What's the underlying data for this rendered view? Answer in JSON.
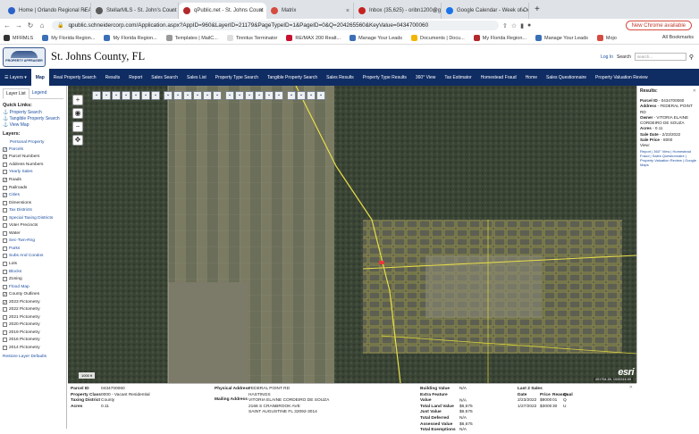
{
  "browser": {
    "tabs": [
      {
        "title": "Home | Orlando Regional REA",
        "color": "#2a62c9",
        "active": false
      },
      {
        "title": "StellarMLS - St. John's Count",
        "color": "#5b5b5b",
        "active": false
      },
      {
        "title": "qPublic.net - St. Johns Count",
        "color": "#b0292b",
        "active": true
      },
      {
        "title": "Matrix",
        "color": "#d64b3f",
        "active": false
      },
      {
        "title": "Inbox (35,625) - oribn1200@g",
        "color": "#c5221f",
        "active": false
      },
      {
        "title": "Google Calendar - Week of Oc",
        "color": "#1a73e8",
        "active": false
      }
    ],
    "url": "qpublic.schneidercorp.com/Application.aspx?AppID=960&LayerID=21179&PageTypeID=1&PageID=0&Q=204265560&KeyValue=0434700060",
    "update_label": "New Chrome available",
    "bookmarks": [
      {
        "label": "MFRMLS",
        "color": "#333"
      },
      {
        "label": "My Florida Region...",
        "color": "#3b6fb6"
      },
      {
        "label": "My Florida Region...",
        "color": "#3b6fb6"
      },
      {
        "label": "Templates | MailC...",
        "color": "#999"
      },
      {
        "label": "Tinnitus Terminator",
        "color": "#ddd"
      },
      {
        "label": "RE/MAX 200 Realt...",
        "color": "#c8102e"
      },
      {
        "label": "Manage Your Leads",
        "color": "#3b6fb6"
      },
      {
        "label": "Documents | Docu...",
        "color": "#f2b600"
      },
      {
        "label": "My Florida Region...",
        "color": "#b0292b"
      },
      {
        "label": "Manage Your Leads",
        "color": "#3b6fb6"
      },
      {
        "label": "Mojo",
        "color": "#d64b3f"
      }
    ],
    "all_bookmarks": "All Bookmarks"
  },
  "site": {
    "logo_text": "PROPERTY APPRAISER",
    "title": "St. Johns County, FL",
    "login": "Log In",
    "search_label": "Search",
    "search_placeholder": "search..."
  },
  "menu": [
    "Layers",
    "Map",
    "Real Property Search",
    "Results",
    "Report",
    "Sales Search",
    "Sales List",
    "Property Type Search",
    "Tangible Property Search",
    "Sales Results",
    "Property Type Results",
    "360° View",
    "Tax Estimator",
    "Homestead Fraud",
    "Home",
    "Sales Questionnaire",
    "Property Valuation Review"
  ],
  "left": {
    "tabs": [
      "Layer List",
      "Legend"
    ],
    "quick_links_title": "Quick Links:",
    "quick_links": [
      "Property Search",
      "Tangible Property Search",
      "View Map"
    ],
    "layers_title": "Layers:",
    "group": "Personal Property",
    "layers": [
      {
        "label": "Parcels",
        "checked": true,
        "link": true
      },
      {
        "label": "Parcel Numbers",
        "checked": true,
        "link": false
      },
      {
        "label": "Address Numbers",
        "checked": false,
        "link": false
      },
      {
        "label": "Yearly Sales",
        "checked": false,
        "link": true
      },
      {
        "label": "Roads",
        "checked": true,
        "link": false
      },
      {
        "label": "Railroads",
        "checked": false,
        "link": false
      },
      {
        "label": "Cities",
        "checked": true,
        "link": true
      },
      {
        "label": "Dimensions",
        "checked": false,
        "link": false
      },
      {
        "label": "Tax Districts",
        "checked": false,
        "link": true
      },
      {
        "label": "Special Taxing Districts",
        "checked": false,
        "link": true
      },
      {
        "label": "Voter Precincts",
        "checked": false,
        "link": false
      },
      {
        "label": "Water",
        "checked": false,
        "link": false
      },
      {
        "label": "Sec-Twn-Rng",
        "checked": false,
        "link": true
      },
      {
        "label": "Parks",
        "checked": false,
        "link": true
      },
      {
        "label": "Subs And Condos",
        "checked": false,
        "link": true
      },
      {
        "label": "Lots",
        "checked": false,
        "link": false
      },
      {
        "label": "Blocks",
        "checked": false,
        "link": true
      },
      {
        "label": "Zoning",
        "checked": false,
        "link": false
      },
      {
        "label": "Flood Map",
        "checked": false,
        "link": true
      },
      {
        "label": "County Outlines",
        "checked": true,
        "link": false
      },
      {
        "label": "2023 Pictometry",
        "checked": true,
        "link": false
      },
      {
        "label": "2022 Pictometry",
        "checked": false,
        "link": false
      },
      {
        "label": "2021 Pictometry",
        "checked": false,
        "link": false
      },
      {
        "label": "2020 Pictometry",
        "checked": false,
        "link": false
      },
      {
        "label": "2019 Pictometry",
        "checked": false,
        "link": false
      },
      {
        "label": "2016 Pictometry",
        "checked": false,
        "link": false
      },
      {
        "label": "2014 Pictometry",
        "checked": false,
        "link": false
      }
    ],
    "restore": "Restore Layer Defaults"
  },
  "map": {
    "scale": "1000 ft",
    "attribution": "esri",
    "coords": "491754.89, 1939316.59"
  },
  "results": {
    "title": "Results:",
    "rows": [
      {
        "k": "Parcel ID",
        "v": "- 0434700060"
      },
      {
        "k": "Address",
        "v": "- FEDERAL POINT RD"
      },
      {
        "k": "Owner",
        "v": "- VITORIA ELAINE CORDEIRO DE SOUZA"
      },
      {
        "k": "Acres",
        "v": "- 0.11"
      },
      {
        "k": "Sale Date",
        "v": "- 2/23/2022"
      },
      {
        "k": "Sale Price",
        "v": "- 8000"
      }
    ],
    "view_label": "View:",
    "links": "Report | 360° View | Homestead Fraud | Sales Questionnaire | Property Valuation Review | Google Maps"
  },
  "bottom": {
    "col1": [
      {
        "k": "Parcel ID",
        "v": "0434700060"
      },
      {
        "k": "Property Class",
        "v": "0000 - Vacant Residential"
      },
      {
        "k": "Taxing District",
        "v": "County"
      },
      {
        "k": "Acres",
        "v": "0.11"
      }
    ],
    "physical_address_label": "Physical Address",
    "physical_address": [
      "FEDERAL POINT RD",
      "HASTINGS"
    ],
    "mailing_address_label": "Mailing Address",
    "mailing_address": [
      "VITORIA ELAINE CORDEIRO DE SOUZA",
      "2166 S CRANBROOK AVE",
      "SAINT AUGUSTINE FL 32092-3014"
    ],
    "values": [
      {
        "k": "Building Value",
        "v": "N/A"
      },
      {
        "k": "Extra Feature Value",
        "v": "N/A"
      },
      {
        "k": "Total Land Value",
        "v": "$6,675"
      },
      {
        "k": "Just Value",
        "v": "$6,675"
      },
      {
        "k": "Total Deferred",
        "v": "N/A"
      },
      {
        "k": "Assessed Value",
        "v": "$6,675"
      },
      {
        "k": "Total Exemptions",
        "v": "N/A"
      }
    ],
    "sales_title": "Last 2 Sales",
    "sales_headers": [
      "Date",
      "Price",
      "Reason",
      "Qual"
    ],
    "sales": [
      [
        "2/23/2022",
        "$8000",
        "01",
        "Q"
      ],
      [
        "1/27/2022",
        "$3000",
        "30",
        "U"
      ]
    ]
  }
}
